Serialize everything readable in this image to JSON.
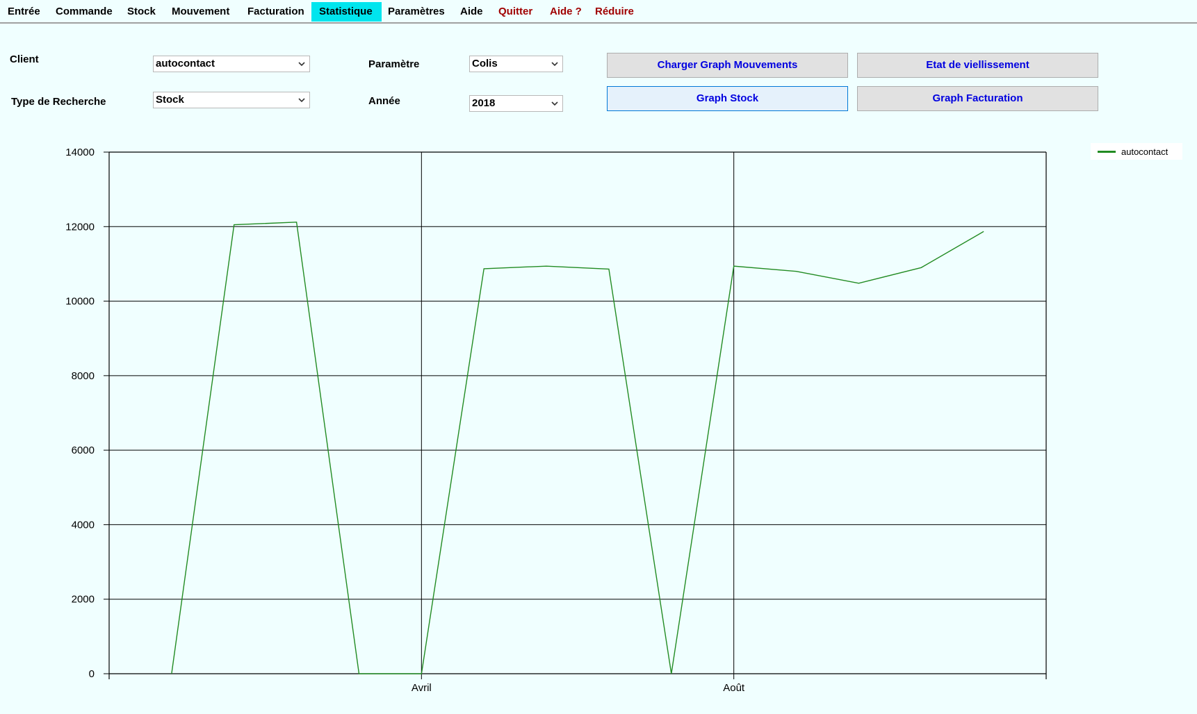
{
  "menu": [
    {
      "label": "Entrée",
      "style": "normal"
    },
    {
      "label": "Commande",
      "style": "normal"
    },
    {
      "label": "Stock",
      "style": "normal"
    },
    {
      "label": "Mouvement",
      "style": "normal"
    },
    {
      "label": "Facturation",
      "style": "normal"
    },
    {
      "label": "Statistique",
      "style": "active"
    },
    {
      "label": "Paramètres",
      "style": "normal"
    },
    {
      "label": "Aide",
      "style": "normal"
    },
    {
      "label": "Quitter",
      "style": "red"
    },
    {
      "label": "Aide ?",
      "style": "red"
    },
    {
      "label": "Réduire",
      "style": "red"
    }
  ],
  "form": {
    "client_label": "Client",
    "client_value": "autocontact",
    "type_label": "Type de Recherche",
    "type_value": "Stock",
    "parametre_label": "Paramètre",
    "parametre_value": "Colis",
    "annee_label": "Année",
    "annee_value": "2018"
  },
  "buttons": {
    "charger_graph": "Charger Graph Mouvements",
    "etat_viellissement": "Etat de viellissement",
    "graph_stock": "Graph Stock",
    "graph_facturation": "Graph Facturation"
  },
  "colors": {
    "accent_active_tab": "#00e5ee",
    "menu_red": "#a00000",
    "button_text": "#0000e0",
    "series": "#228b22"
  },
  "chart_data": {
    "type": "line",
    "x": [
      1,
      2,
      3,
      4,
      5,
      6,
      7,
      8,
      9,
      10,
      11,
      12,
      13,
      14,
      15
    ],
    "x_tick_labels": [
      {
        "x": 5,
        "label": "Avril"
      },
      {
        "x": 10,
        "label": "Août"
      }
    ],
    "x_range": [
      0,
      15
    ],
    "ylim": [
      0,
      14000
    ],
    "y_ticks": [
      0,
      2000,
      4000,
      6000,
      8000,
      10000,
      12000,
      14000
    ],
    "grid": true,
    "legend_position": "top-right",
    "series": [
      {
        "name": "autocontact",
        "color": "#228b22",
        "values": [
          0,
          12050,
          12120,
          0,
          0,
          10870,
          10940,
          10860,
          0,
          10940,
          10800,
          10480,
          10900,
          11870
        ]
      }
    ]
  }
}
